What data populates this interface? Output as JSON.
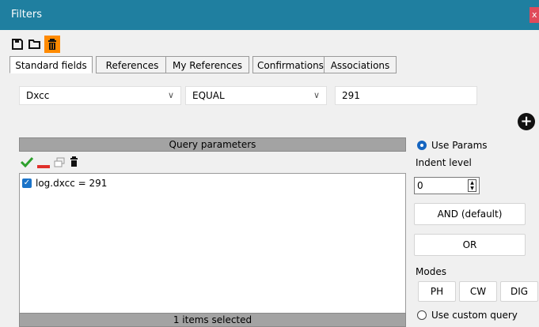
{
  "window": {
    "title": "Filters",
    "close_label": "x"
  },
  "toolbar": {
    "items": [
      "save-icon",
      "open-folder-icon",
      "trash-icon"
    ]
  },
  "tabs": [
    "Standard fields",
    "References",
    "My References",
    "Confirmations",
    "Associations"
  ],
  "filter": {
    "field": "Dxcc",
    "operator": "EQUAL",
    "value": "291",
    "add_label": "+"
  },
  "query": {
    "header": "Query parameters",
    "tools": [
      "check-icon",
      "minus-icon",
      "copy-icon",
      "trash-icon"
    ],
    "items": [
      {
        "checked": true,
        "text": "log.dxcc = 291"
      }
    ],
    "status": "1 items selected"
  },
  "right": {
    "use_params_label": "Use Params",
    "use_params_selected": true,
    "indent_label": "Indent level",
    "indent_value": "0",
    "and_label": "AND (default)",
    "or_label": "OR",
    "modes_label": "Modes",
    "modes": [
      "PH",
      "CW",
      "DIG"
    ],
    "custom_query_label": "Use custom query",
    "custom_query_selected": false
  },
  "colors": {
    "titlebar": "#1f7fa0",
    "active_toolbar": "#ff8a00",
    "radio_selected": "#1565c0",
    "check": "#1a73c8"
  }
}
